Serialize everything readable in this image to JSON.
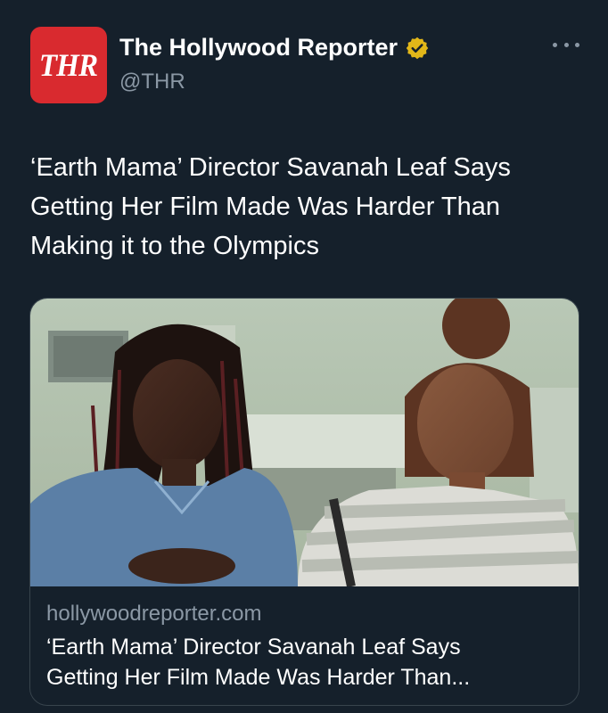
{
  "author": {
    "avatar_text": "THR",
    "display_name": "The Hollywood Reporter",
    "handle": "@THR",
    "verified_icon": "gold-verified-badge-icon",
    "brand_color": "#d92a2f",
    "badge_color": "#e2b719"
  },
  "tweet": {
    "text": "‘Earth Mama’ Director Savanah Leaf Says Getting Her Film Made Was Harder Than Making it to the Olympics"
  },
  "card": {
    "image_icon": "photo-two-women-seated",
    "domain": "hollywoodreporter.com",
    "title_line1": "‘Earth Mama’ Director Savanah Leaf Says",
    "title_line2": "Getting Her Film Made Was Harder Than..."
  },
  "theme": {
    "background": "#15202b",
    "secondary_text": "#8b98a5",
    "border": "#38444d"
  }
}
